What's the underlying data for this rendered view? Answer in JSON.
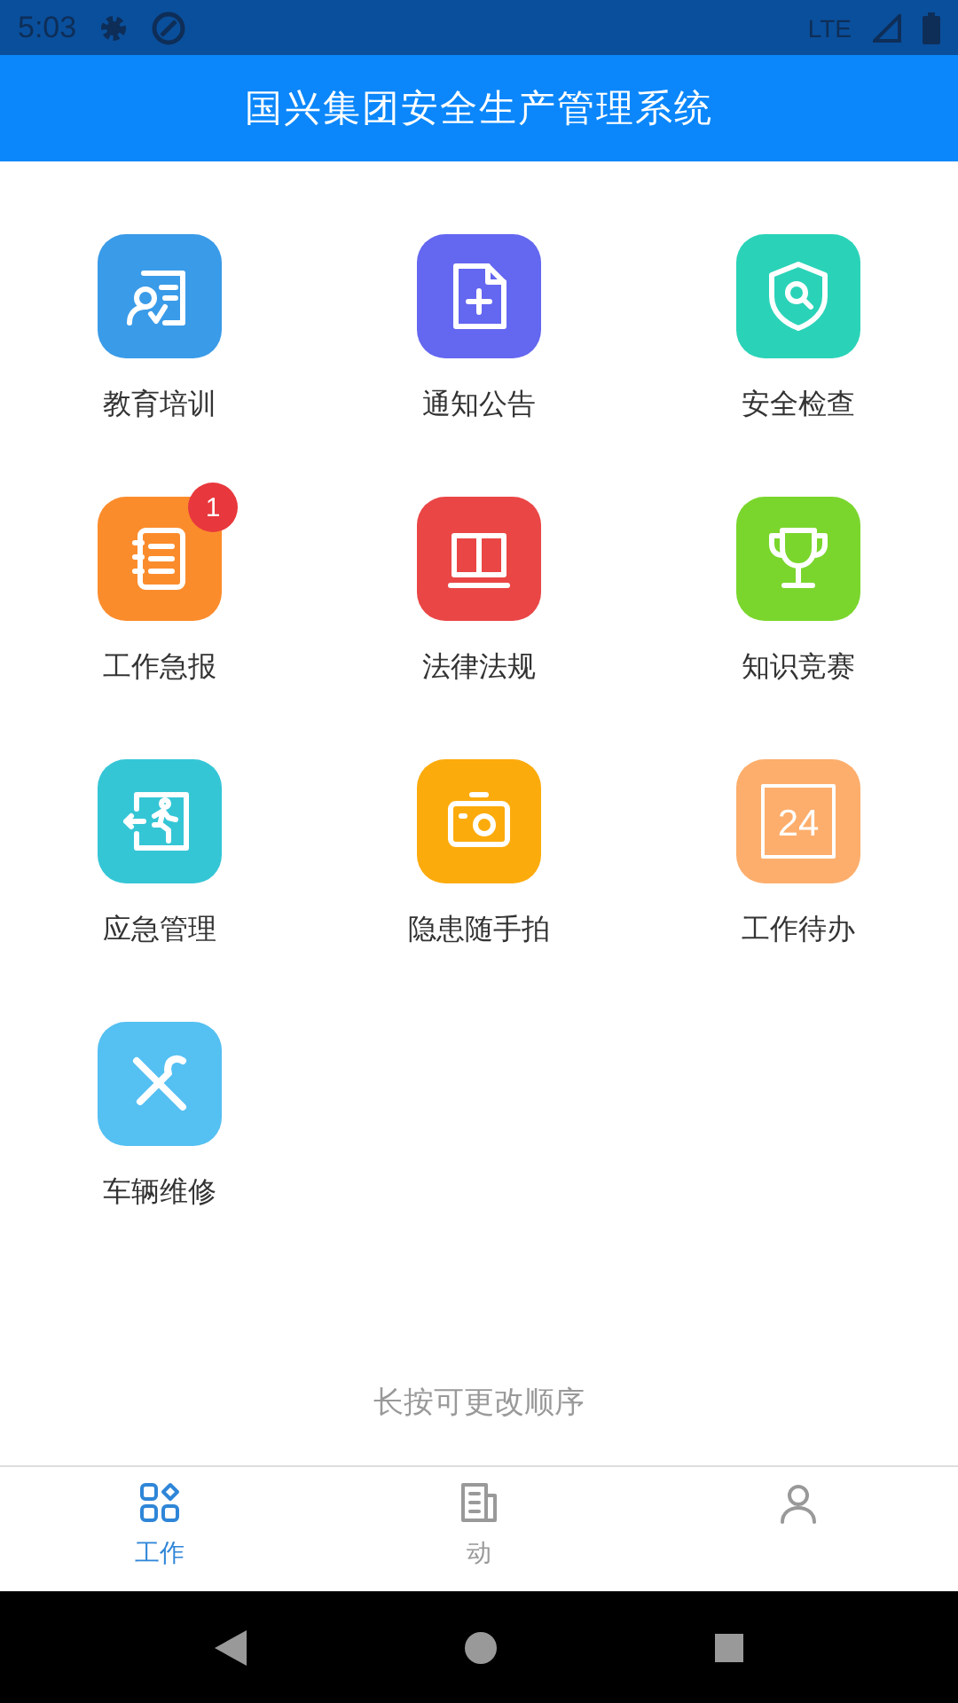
{
  "status_bar": {
    "time": "5:03",
    "network": "LTE"
  },
  "header": {
    "title": "国兴集团安全生产管理系统"
  },
  "apps": [
    {
      "label": "教育培训",
      "kind": "training",
      "color": "#3a9be8"
    },
    {
      "label": "通知公告",
      "kind": "notice",
      "color": "#6467f0"
    },
    {
      "label": "安全检查",
      "kind": "inspect",
      "color": "#2ad3b8"
    },
    {
      "label": "工作急报",
      "kind": "report",
      "color": "#fb8c2c",
      "badge": "1"
    },
    {
      "label": "法律法规",
      "kind": "law",
      "color": "#ea4646"
    },
    {
      "label": "知识竞赛",
      "kind": "trophy",
      "color": "#7ad62c"
    },
    {
      "label": "应急管理",
      "kind": "exit",
      "color": "#35c6d6"
    },
    {
      "label": "隐患随手拍",
      "kind": "camera",
      "color": "#fcab0c"
    },
    {
      "label": "工作待办",
      "kind": "todo",
      "color": "#fdae6c",
      "icon_text": "24"
    },
    {
      "label": "车辆维修",
      "kind": "repair",
      "color": "#55c0f2"
    }
  ],
  "hint": "长按可更改顺序",
  "tabs": [
    {
      "label": "工作",
      "kind": "grid",
      "selected": true
    },
    {
      "label": "动",
      "kind": "news",
      "selected": false
    },
    {
      "kind": "person",
      "selected": false
    }
  ]
}
